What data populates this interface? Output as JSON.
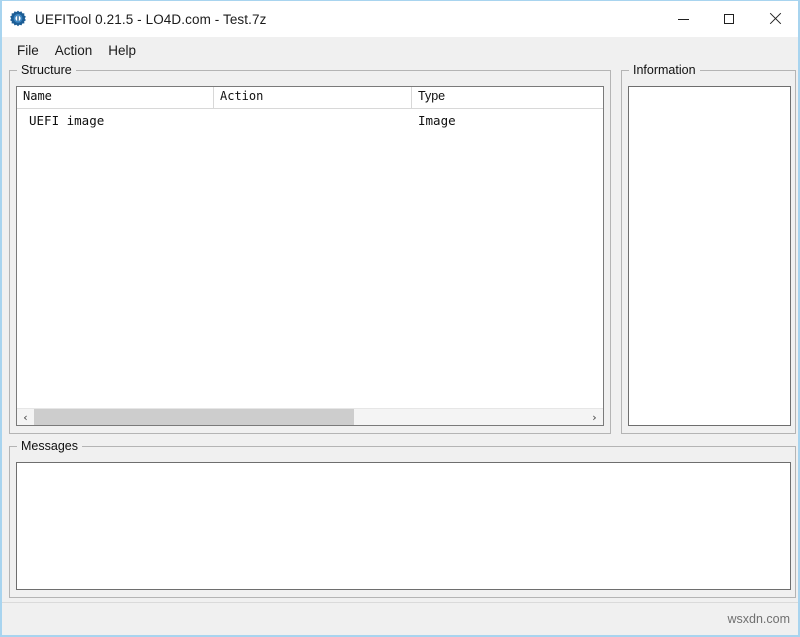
{
  "window": {
    "title": "UEFITool 0.21.5 - LO4D.com - Test.7z",
    "icon": "gear-icon",
    "accent_border": "#a8d4ef",
    "controls": {
      "minimize": "minimize-icon",
      "maximize": "maximize-icon",
      "close": "close-icon"
    }
  },
  "menubar": {
    "items": [
      {
        "label": "File"
      },
      {
        "label": "Action"
      },
      {
        "label": "Help"
      }
    ]
  },
  "structure": {
    "group_label": "Structure",
    "columns": [
      {
        "label": "Name"
      },
      {
        "label": "Action"
      },
      {
        "label": "Type"
      }
    ],
    "rows": [
      {
        "name": "UEFI image",
        "action": "",
        "type": "Image"
      }
    ],
    "scrollbar": {
      "left_arrow": "‹",
      "right_arrow": "›",
      "thumb_fraction": 58
    }
  },
  "information": {
    "group_label": "Information",
    "content": ""
  },
  "messages": {
    "group_label": "Messages",
    "content": ""
  },
  "statusbar": {
    "watermark": "wsxdn.com"
  }
}
